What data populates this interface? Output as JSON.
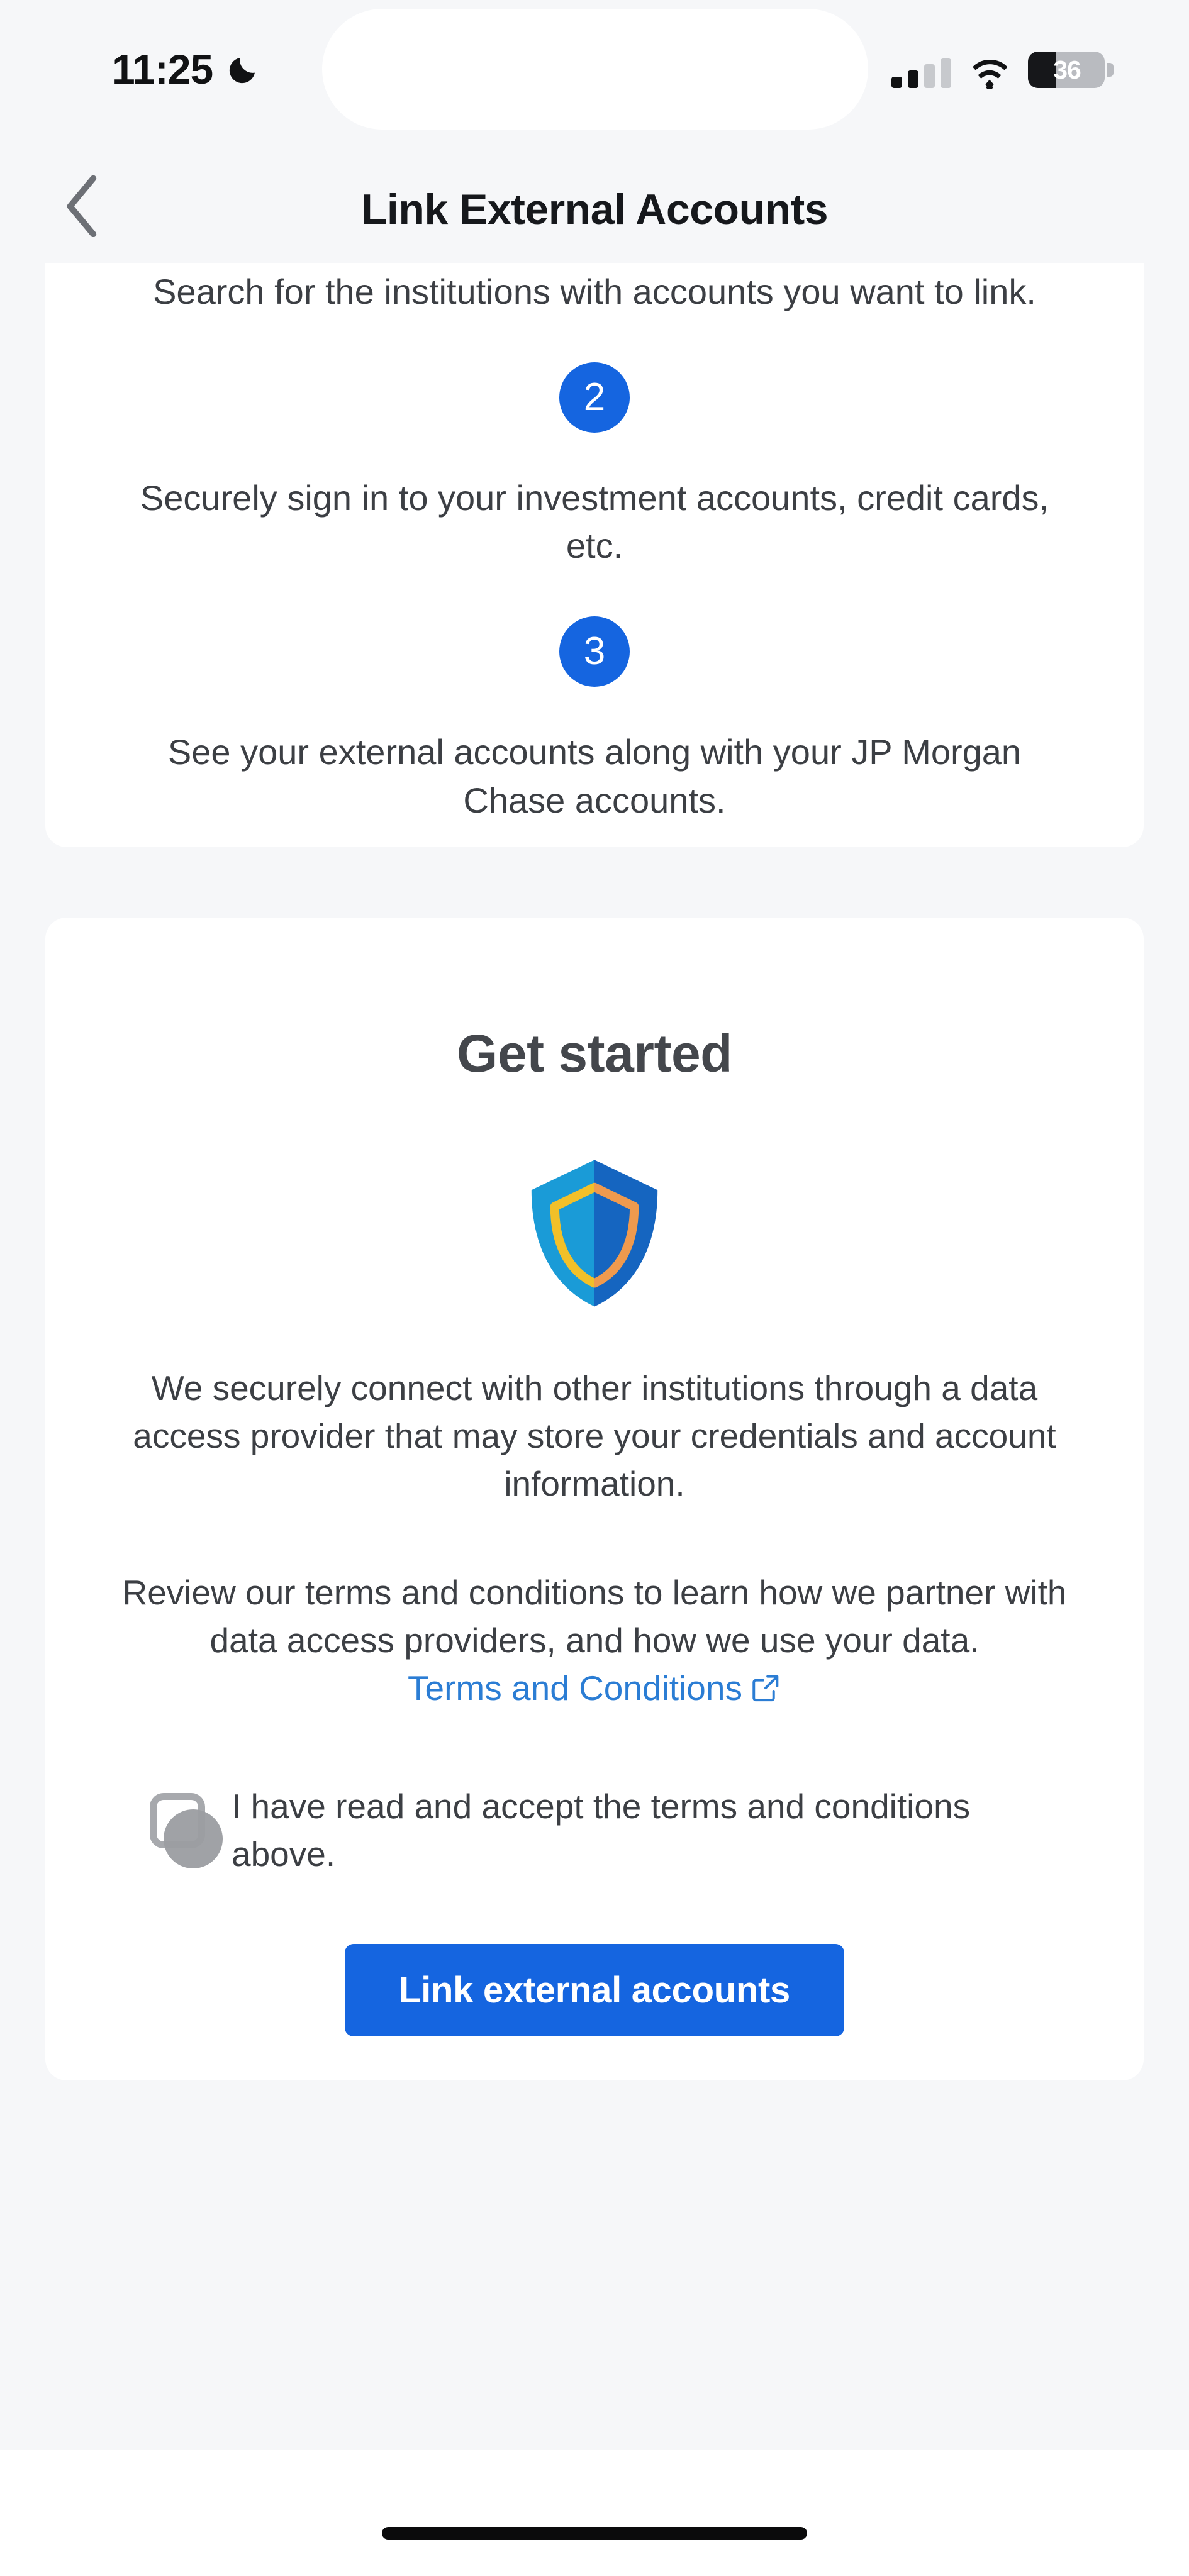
{
  "status_bar": {
    "time": "11:25",
    "dnd_icon": "crescent-moon-icon",
    "signal_icon": "cellular-signal-icon",
    "signal_bars_filled": 2,
    "signal_bars_total": 4,
    "wifi_icon": "wifi-icon",
    "battery_level": "36",
    "battery_percent": 36,
    "battery_icon": "battery-icon"
  },
  "nav": {
    "back_icon": "chevron-left-icon",
    "title": "Link External Accounts"
  },
  "steps_card": {
    "step1_text": "Search for the institutions with accounts you want to link.",
    "step2_badge": "2",
    "step2_text": "Securely sign in to your investment accounts, credit cards, etc.",
    "step3_badge": "3",
    "step3_text": "See your external accounts along with your JP Morgan Chase accounts."
  },
  "get_started_card": {
    "heading": "Get started",
    "shield_icon": "shield-icon",
    "secure_paragraph": "We securely connect with other institutions through a data access provider that may store your credentials and account information.",
    "terms_paragraph_before": "Review our terms and conditions to learn how we partner with data access providers, and how we use your data.",
    "terms_link_label": "Terms and Conditions",
    "external_link_icon": "external-link-icon",
    "accept_checkbox_checked": false,
    "accept_label": "I have read and accept the terms and conditions above.",
    "primary_button_label": "Link external accounts"
  },
  "bottom": {
    "home_indicator": "home-indicator"
  },
  "colors": {
    "page_background": "#f6f7f9",
    "card_background": "#ffffff",
    "accent_blue": "#1565e0",
    "link_blue": "#2b7dd4",
    "body_text": "#3c3f44",
    "title_text": "#16181c",
    "heading_text": "#44474c",
    "shield_left": "#1a9bd7",
    "shield_right": "#1565c0",
    "shield_inner_left": "#f2c029",
    "shield_inner_right": "#ef9a4e",
    "checkbox_border": "#a7a9ad",
    "checkbox_ripple": "#9b9da1"
  }
}
